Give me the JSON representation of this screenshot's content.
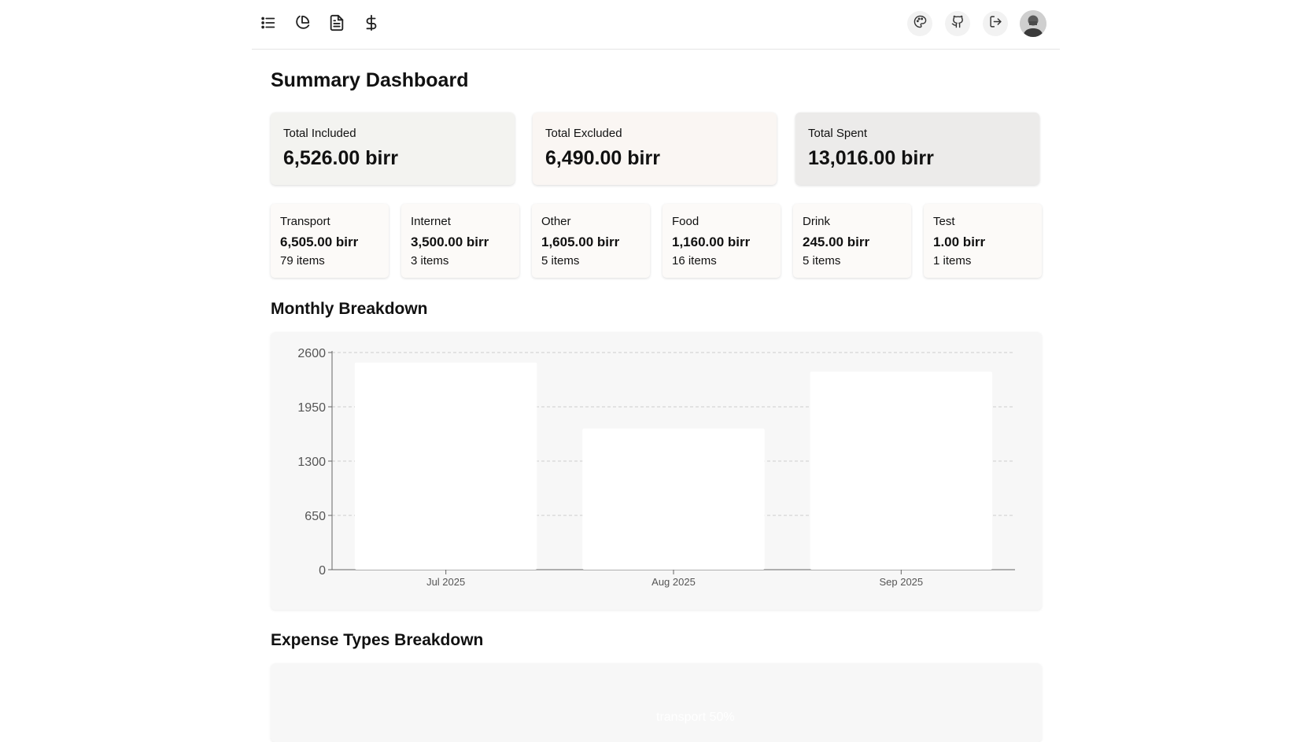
{
  "nav": {
    "icons": [
      "list-icon",
      "pie-chart-icon",
      "file-text-icon",
      "dollar-icon"
    ],
    "actions": [
      "palette-icon",
      "github-icon",
      "logout-icon"
    ]
  },
  "page": {
    "title": "Summary Dashboard"
  },
  "summary": [
    {
      "label": "Total Included",
      "value": "6,526.00 birr",
      "bg": "#f3f3f0"
    },
    {
      "label": "Total Excluded",
      "value": "6,490.00 birr",
      "bg": "#faf6f3"
    },
    {
      "label": "Total Spent",
      "value": "13,016.00 birr",
      "bg": "#ecebea"
    }
  ],
  "categories": [
    {
      "name": "Transport",
      "amount": "6,505.00 birr",
      "count": "79 items"
    },
    {
      "name": "Internet",
      "amount": "3,500.00 birr",
      "count": "3 items"
    },
    {
      "name": "Other",
      "amount": "1,605.00 birr",
      "count": "5 items"
    },
    {
      "name": "Food",
      "amount": "1,160.00 birr",
      "count": "16 items"
    },
    {
      "name": "Drink",
      "amount": "245.00 birr",
      "count": "5 items"
    },
    {
      "name": "Test",
      "amount": "1.00 birr",
      "count": "1 items"
    }
  ],
  "sections": {
    "monthly": "Monthly Breakdown",
    "types": "Expense Types Breakdown"
  },
  "chart_data": {
    "type": "bar",
    "categories": [
      "Jul 2025",
      "Aug 2025",
      "Sep 2025"
    ],
    "values": [
      2480,
      1690,
      2370
    ],
    "ylim": [
      0,
      2600
    ],
    "yticks": [
      "0",
      "650",
      "1300",
      "1950",
      "2600"
    ],
    "grid": true,
    "bar_color": "#ffffff"
  },
  "pie": {
    "visible_label": "transport 50%"
  }
}
